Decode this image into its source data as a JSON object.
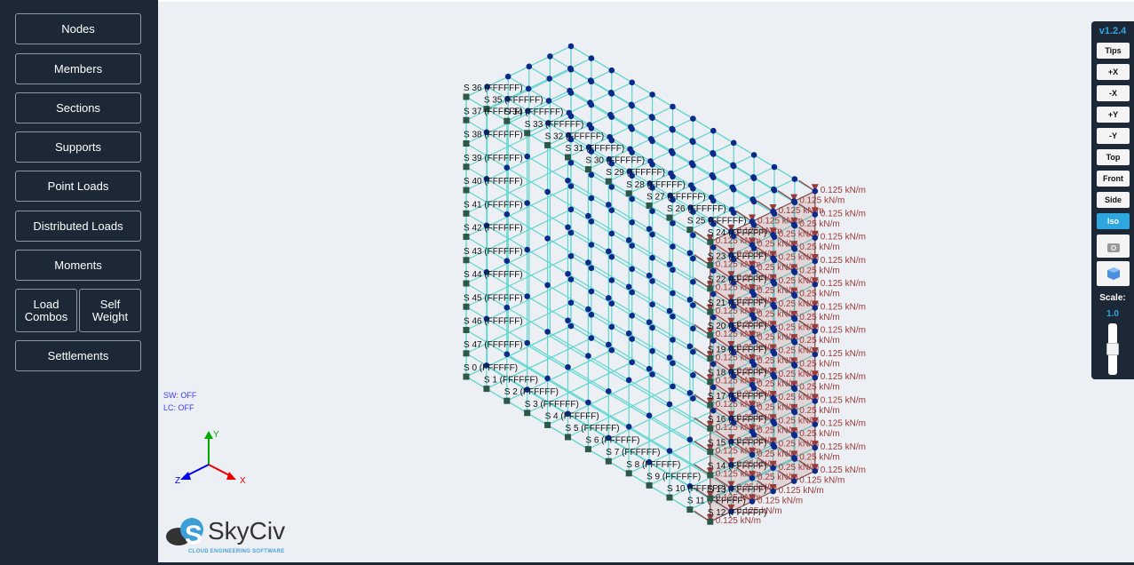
{
  "sidebar": {
    "buttons": [
      "Nodes",
      "Members",
      "Sections",
      "Supports",
      "Point Loads",
      "Distributed Loads",
      "Moments"
    ],
    "load_combos": "Load\nCombos",
    "self_weight": "Self\nWeight",
    "settlements": "Settlements"
  },
  "toolbar": {
    "version": "v1.2.4",
    "buttons": [
      "Tips",
      "+X",
      "-X",
      "+Y",
      "-Y",
      "Top",
      "Front",
      "Side",
      "Iso"
    ],
    "active": "Iso",
    "icons": [
      "camera-icon",
      "cube-icon"
    ],
    "scale_label": "Scale:",
    "scale_value": "1.0"
  },
  "status": {
    "sw": "SW: OFF",
    "lc": "LC: OFF"
  },
  "axes": {
    "x": "X",
    "y": "Y",
    "z": "Z"
  },
  "logo": {
    "name": "SkyCiv",
    "tagline": "CLOUD ENGINEERING SOFTWARE"
  },
  "supports": {
    "prefix": "S",
    "fixity": "FFFFFF",
    "count": 48
  },
  "loads": {
    "edge_label": "0.125 kN/m",
    "interior_label": "0.25 kN/m",
    "color": "#9a3a3a"
  },
  "colors": {
    "member": "#5fd6cf",
    "node": "#0d2a8a",
    "support": "#2e5748",
    "sidebar": "#1d2837",
    "accent": "#2ea7e0"
  }
}
